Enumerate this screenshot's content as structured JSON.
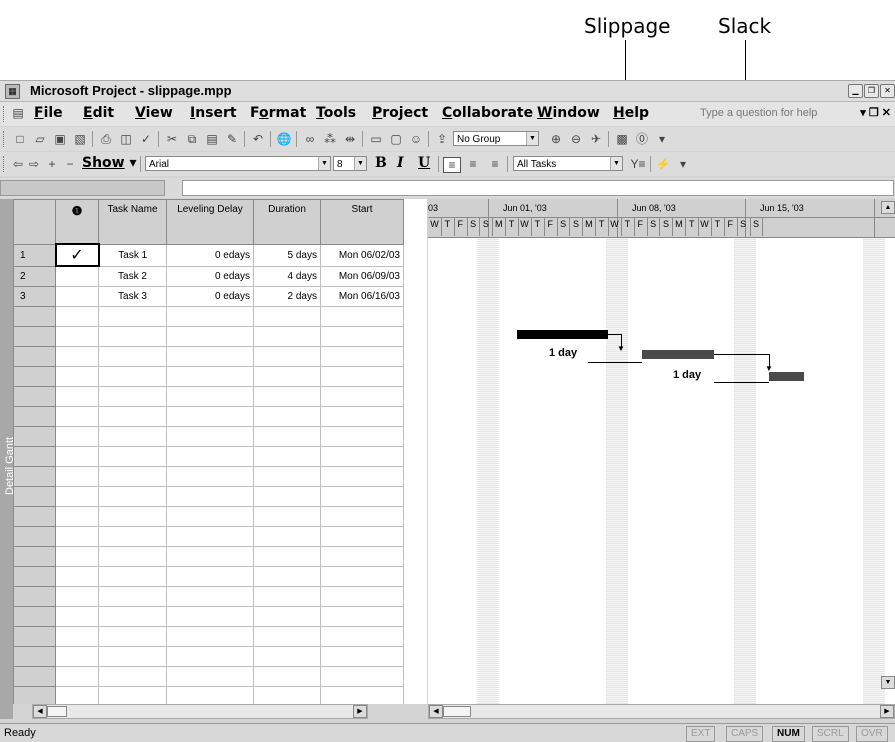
{
  "callouts": {
    "slippage": "Slippage",
    "slack": "Slack"
  },
  "window": {
    "title": "Microsoft Project - slippage.mpp"
  },
  "menu": {
    "items": [
      {
        "key": "F",
        "rest": "ile"
      },
      {
        "key": "E",
        "rest": "dit"
      },
      {
        "key": "V",
        "rest": "iew"
      },
      {
        "key": "I",
        "rest": "nsert"
      },
      {
        "pre": "F",
        "key": "o",
        "rest": "rmat"
      },
      {
        "key": "T",
        "rest": "ools"
      },
      {
        "key": "P",
        "rest": "roject"
      },
      {
        "key": "C",
        "rest": "ollaborate"
      },
      {
        "key": "W",
        "rest": "indow"
      },
      {
        "key": "H",
        "rest": "elp"
      }
    ],
    "help_placeholder": "Type a question for help"
  },
  "toolbar": {
    "group_dropdown": "No Group",
    "show_label": "Show",
    "font": "Arial",
    "font_size": "8",
    "bold": "B",
    "italic": "I",
    "underline": "U",
    "filter": "All Tasks"
  },
  "view_bar_label": "Detail Gantt",
  "table": {
    "columns": [
      "Task Name",
      "Leveling Delay",
      "Duration",
      "Start"
    ],
    "rows": [
      {
        "id": "1",
        "indicator": "✓",
        "name": "Task 1",
        "delay": "0 edays",
        "duration": "5 days",
        "start": "Mon 06/02/03"
      },
      {
        "id": "2",
        "indicator": "",
        "name": "Task 2",
        "delay": "0 edays",
        "duration": "4 days",
        "start": "Mon 06/09/03"
      },
      {
        "id": "3",
        "indicator": "",
        "name": "Task 3",
        "delay": "0 edays",
        "duration": "2 days",
        "start": "Mon 06/16/03"
      }
    ]
  },
  "gantt": {
    "weeks": [
      "03",
      "Jun 01, '03",
      "Jun 08, '03",
      "Jun 15, '03"
    ],
    "days": [
      "W",
      "T",
      "F",
      "S",
      "S",
      "M",
      "T",
      "W",
      "T",
      "F",
      "S",
      "S",
      "M",
      "T",
      "W",
      "T",
      "F",
      "S",
      "S",
      "M",
      "T",
      "W",
      "T",
      "F",
      "S",
      "S"
    ],
    "slippage_label": "1 day",
    "slack_label": "1 day"
  },
  "status": {
    "text": "Ready",
    "indicators": [
      {
        "label": "EXT",
        "on": false
      },
      {
        "label": "CAPS",
        "on": false
      },
      {
        "label": "NUM",
        "on": true
      },
      {
        "label": "SCRL",
        "on": false
      },
      {
        "label": "OVR",
        "on": false
      }
    ]
  }
}
